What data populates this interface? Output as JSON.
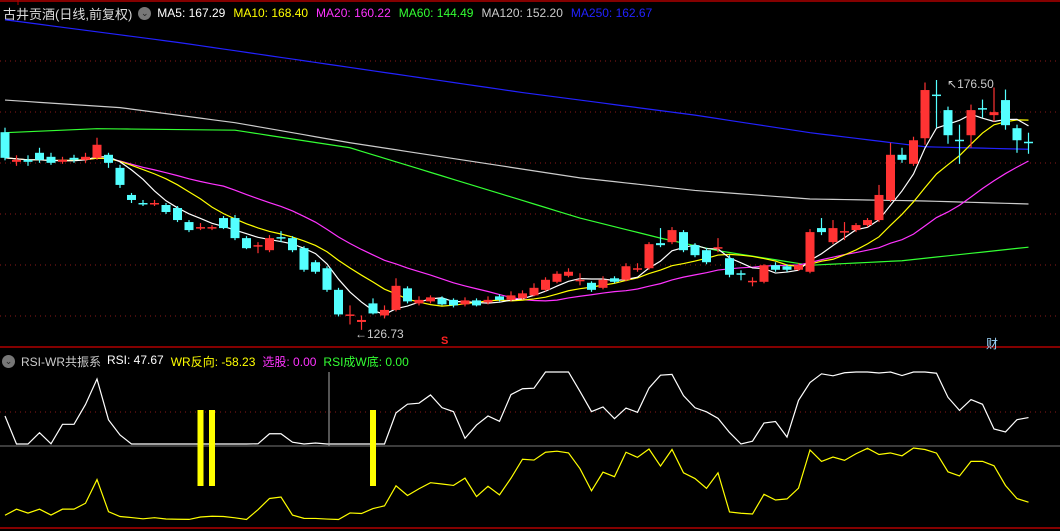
{
  "header": {
    "title": "古井贡酒(日线,前复权)",
    "ma": [
      {
        "label": "MA5: 167.29",
        "color": "#ffffff"
      },
      {
        "label": "MA10: 168.40",
        "color": "#ffff00"
      },
      {
        "label": "MA20: 160.22",
        "color": "#ff33ff"
      },
      {
        "label": "MA60: 144.49",
        "color": "#33ff33"
      },
      {
        "label": "MA120: 152.20",
        "color": "#cccccc"
      },
      {
        "label": "MA250: 162.67",
        "color": "#2222ff"
      }
    ]
  },
  "indicator": {
    "name": "RSI-WR共振系",
    "values": [
      {
        "label": "RSI: 47.67",
        "color": "#ffffff"
      },
      {
        "label": "WR反向: -58.23",
        "color": "#ffff00"
      },
      {
        "label": "选股: 0.00",
        "color": "#ff33ff"
      },
      {
        "label": "RSI成W底: 0.00",
        "color": "#33ff33"
      }
    ]
  },
  "annotations": {
    "high": "176.50",
    "low": "126.73",
    "marker_s": "S",
    "marker_cai": "财"
  },
  "colors": {
    "up": "#ff3333",
    "down": "#54ffff",
    "grid": "#8b1a1a",
    "ma5": "#ffffff",
    "ma10": "#ffff00",
    "ma20": "#ff33ff",
    "ma60": "#33ff33",
    "ma120": "#cccccc",
    "ma250": "#2222ff",
    "signal": "#ffff00"
  },
  "chart_data": {
    "type": "candlestick",
    "ylim": [
      126.73,
      176.5
    ],
    "candles": [
      [
        166.1,
        161.0,
        167.0,
        160.5
      ],
      [
        160.2,
        160.6,
        161.5,
        159.4
      ],
      [
        160.6,
        160.2,
        161.5,
        159.4
      ],
      [
        162.0,
        160.6,
        163.0,
        160.0
      ],
      [
        161.2,
        160.0,
        162.0,
        159.6
      ],
      [
        160.2,
        160.6,
        161.2,
        159.8
      ],
      [
        161.0,
        160.6,
        161.6,
        160.0
      ],
      [
        160.6,
        161.2,
        162.0,
        160.0
      ],
      [
        161.0,
        163.6,
        165.0,
        160.6
      ],
      [
        161.6,
        160.0,
        162.0,
        159.0
      ],
      [
        159.0,
        155.6,
        159.6,
        155.0
      ],
      [
        153.6,
        152.6,
        154.0,
        152.0
      ],
      [
        152.0,
        151.8,
        152.6,
        151.4
      ],
      [
        151.8,
        152.0,
        152.6,
        151.4
      ],
      [
        151.6,
        150.2,
        152.0,
        149.8
      ],
      [
        151.0,
        148.6,
        151.4,
        148.2
      ],
      [
        148.2,
        146.6,
        148.6,
        146.2
      ],
      [
        147.0,
        147.2,
        148.0,
        146.6
      ],
      [
        147.0,
        147.2,
        147.6,
        146.6
      ],
      [
        149.0,
        147.0,
        149.4,
        146.8
      ],
      [
        149.0,
        145.0,
        149.6,
        144.6
      ],
      [
        145.0,
        143.0,
        145.4,
        142.8
      ],
      [
        143.4,
        143.6,
        144.2,
        142.0
      ],
      [
        142.6,
        145.0,
        145.6,
        142.2
      ],
      [
        145.2,
        145.0,
        146.4,
        144.2
      ],
      [
        145.0,
        142.6,
        145.4,
        142.2
      ],
      [
        143.0,
        138.7,
        143.4,
        138.3
      ],
      [
        140.2,
        138.3,
        140.6,
        137.9
      ],
      [
        139.0,
        134.7,
        139.4,
        134.3
      ],
      [
        134.7,
        129.8,
        135.1,
        129.4
      ],
      [
        129.6,
        129.8,
        131.6,
        127.8
      ],
      [
        128.3,
        128.7,
        129.6,
        126.73
      ],
      [
        132.0,
        130.0,
        133.0,
        129.8
      ],
      [
        129.6,
        130.7,
        131.6,
        129.0
      ],
      [
        130.7,
        135.5,
        137.0,
        130.4
      ],
      [
        135.0,
        132.4,
        135.4,
        132.0
      ],
      [
        132.0,
        132.7,
        133.4,
        131.6
      ],
      [
        132.4,
        133.2,
        133.6,
        132.0
      ],
      [
        133.0,
        131.8,
        133.4,
        131.6
      ],
      [
        132.7,
        131.6,
        133.0,
        131.2
      ],
      [
        131.8,
        132.6,
        133.2,
        131.4
      ],
      [
        132.6,
        131.6,
        133.0,
        131.4
      ],
      [
        132.2,
        132.7,
        133.4,
        131.8
      ],
      [
        133.4,
        132.7,
        133.8,
        132.4
      ],
      [
        132.7,
        133.6,
        134.4,
        132.4
      ],
      [
        133.0,
        134.0,
        134.6,
        132.8
      ],
      [
        133.6,
        135.1,
        136.0,
        133.4
      ],
      [
        134.7,
        136.7,
        137.2,
        134.4
      ],
      [
        136.3,
        137.9,
        138.4,
        136.0
      ],
      [
        137.5,
        138.3,
        139.0,
        137.2
      ],
      [
        136.5,
        136.7,
        138.0,
        135.6
      ],
      [
        136.1,
        134.7,
        136.4,
        134.3
      ],
      [
        135.1,
        136.7,
        137.4,
        134.8
      ],
      [
        137.0,
        136.3,
        137.4,
        136.0
      ],
      [
        136.7,
        139.4,
        140.0,
        136.4
      ],
      [
        138.7,
        139.0,
        140.0,
        138.3
      ],
      [
        139.0,
        143.8,
        144.2,
        138.7
      ],
      [
        144.0,
        143.6,
        147.0,
        143.2
      ],
      [
        144.2,
        146.6,
        147.2,
        143.8
      ],
      [
        146.2,
        142.6,
        146.6,
        142.2
      ],
      [
        143.6,
        141.6,
        144.0,
        141.2
      ],
      [
        142.6,
        140.2,
        143.0,
        139.8
      ],
      [
        143.0,
        143.2,
        145.0,
        142.2
      ],
      [
        141.0,
        137.7,
        141.6,
        137.2
      ],
      [
        138.0,
        137.7,
        138.6,
        136.6
      ],
      [
        136.3,
        136.5,
        137.2,
        135.4
      ],
      [
        136.3,
        139.6,
        139.8,
        136.0
      ],
      [
        139.6,
        138.7,
        140.2,
        138.3
      ],
      [
        139.4,
        138.7,
        139.8,
        138.3
      ],
      [
        138.7,
        139.6,
        140.0,
        138.5
      ],
      [
        138.3,
        146.2,
        146.8,
        138.0
      ],
      [
        147.0,
        146.2,
        149.0,
        145.6
      ],
      [
        144.2,
        147.0,
        148.6,
        143.8
      ],
      [
        146.2,
        146.4,
        148.2,
        144.6
      ],
      [
        146.6,
        147.6,
        148.0,
        146.2
      ],
      [
        147.6,
        148.6,
        149.0,
        147.2
      ],
      [
        148.6,
        153.6,
        155.6,
        148.2
      ],
      [
        152.6,
        161.6,
        164.0,
        152.2
      ],
      [
        161.6,
        160.6,
        163.0,
        160.0
      ],
      [
        159.8,
        164.5,
        165.2,
        159.4
      ],
      [
        164.9,
        174.5,
        176.0,
        163.6
      ],
      [
        173.6,
        173.4,
        176.5,
        167.0
      ],
      [
        170.5,
        165.5,
        171.2,
        163.8
      ],
      [
        164.6,
        164.4,
        167.6,
        159.8
      ],
      [
        165.5,
        170.5,
        171.6,
        163.0
      ],
      [
        170.9,
        170.7,
        172.6,
        169.0
      ],
      [
        169.5,
        170.1,
        175.0,
        168.2
      ],
      [
        172.5,
        167.5,
        174.6,
        166.6
      ],
      [
        166.9,
        164.5,
        167.6,
        162.0
      ],
      [
        164.2,
        164.0,
        166.0,
        161.8
      ]
    ],
    "ma60": [
      [
        0,
        166.0
      ],
      [
        8,
        166.8
      ],
      [
        20,
        166.5
      ],
      [
        30,
        163
      ],
      [
        40,
        156
      ],
      [
        50,
        149
      ],
      [
        57,
        145
      ],
      [
        62,
        142.5
      ],
      [
        70,
        139.6
      ],
      [
        78,
        140.5
      ],
      [
        89,
        143.2
      ]
    ],
    "ma120": [
      [
        0,
        172.5
      ],
      [
        10,
        171
      ],
      [
        20,
        168
      ],
      [
        30,
        164
      ],
      [
        40,
        160.5
      ],
      [
        50,
        157
      ],
      [
        60,
        154.5
      ],
      [
        70,
        152.8
      ],
      [
        80,
        152.4
      ],
      [
        89,
        151.8
      ]
    ],
    "ma250": [
      [
        0,
        188.5
      ],
      [
        15,
        184
      ],
      [
        30,
        179
      ],
      [
        45,
        174
      ],
      [
        60,
        169.5
      ],
      [
        70,
        166
      ],
      [
        80,
        163.2
      ],
      [
        89,
        162.7
      ]
    ],
    "signals": [
      17,
      18,
      32
    ],
    "marker_index": 28
  }
}
